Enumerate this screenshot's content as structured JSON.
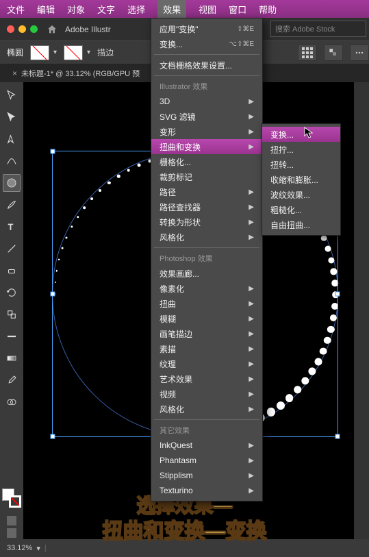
{
  "menubar": {
    "items": [
      "文件",
      "编辑",
      "对象",
      "文字",
      "选择",
      "效果",
      "视图",
      "窗口",
      "帮助"
    ],
    "open_index": 5
  },
  "appbar": {
    "app_name": "Adobe Illustr"
  },
  "search": {
    "placeholder": "搜索 Adobe Stock"
  },
  "property_bar": {
    "shape_label": "椭圆",
    "stroke_label": "描边"
  },
  "doc_tab": {
    "title": "未标题-1* @ 33.12% (RGB/GPU 预"
  },
  "effect_menu": {
    "top": [
      {
        "label": "应用\"变换\"",
        "shortcut": "⇧⌘E"
      },
      {
        "label": "变换...",
        "shortcut": "⌥⇧⌘E"
      }
    ],
    "doc_settings": "文档栅格效果设置...",
    "section1_header": "Illustrator 效果",
    "section1": [
      {
        "label": "3D",
        "sub": true
      },
      {
        "label": "SVG 滤镜",
        "sub": true
      },
      {
        "label": "变形",
        "sub": true
      },
      {
        "label": "扭曲和变换",
        "sub": true,
        "highlight": true
      },
      {
        "label": "栅格化..."
      },
      {
        "label": "裁剪标记"
      },
      {
        "label": "路径",
        "sub": true
      },
      {
        "label": "路径查找器",
        "sub": true
      },
      {
        "label": "转换为形状",
        "sub": true
      },
      {
        "label": "风格化",
        "sub": true
      }
    ],
    "section2_header": "Photoshop 效果",
    "section2": [
      {
        "label": "效果画廊..."
      },
      {
        "label": "像素化",
        "sub": true
      },
      {
        "label": "扭曲",
        "sub": true
      },
      {
        "label": "模糊",
        "sub": true
      },
      {
        "label": "画笔描边",
        "sub": true
      },
      {
        "label": "素描",
        "sub": true
      },
      {
        "label": "纹理",
        "sub": true
      },
      {
        "label": "艺术效果",
        "sub": true
      },
      {
        "label": "视频",
        "sub": true
      },
      {
        "label": "风格化",
        "sub": true
      }
    ],
    "section3_header": "其它效果",
    "section3": [
      {
        "label": "InkQuest",
        "sub": true
      },
      {
        "label": "Phantasm",
        "sub": true
      },
      {
        "label": "Stipplism",
        "sub": true
      },
      {
        "label": "Texturino",
        "sub": true
      }
    ]
  },
  "distort_submenu": {
    "items": [
      {
        "label": "变换...",
        "highlight": true
      },
      {
        "label": "扭拧..."
      },
      {
        "label": "扭转..."
      },
      {
        "label": "收缩和膨胀..."
      },
      {
        "label": "波纹效果..."
      },
      {
        "label": "粗糙化..."
      },
      {
        "label": "自由扭曲..."
      }
    ]
  },
  "status": {
    "zoom": "33.12%"
  },
  "caption": {
    "line1": "选择效果—",
    "line2": "扭曲和变换—变换"
  },
  "tools": [
    "selection",
    "direct-selection",
    "pen",
    "curvature",
    "ellipse",
    "brush",
    "type",
    "line",
    "eraser",
    "rotate",
    "scale",
    "width",
    "gradient",
    "eyedropper",
    "blend",
    "symbol-sprayer",
    "artboard",
    "slice",
    "hand",
    "zoom"
  ]
}
